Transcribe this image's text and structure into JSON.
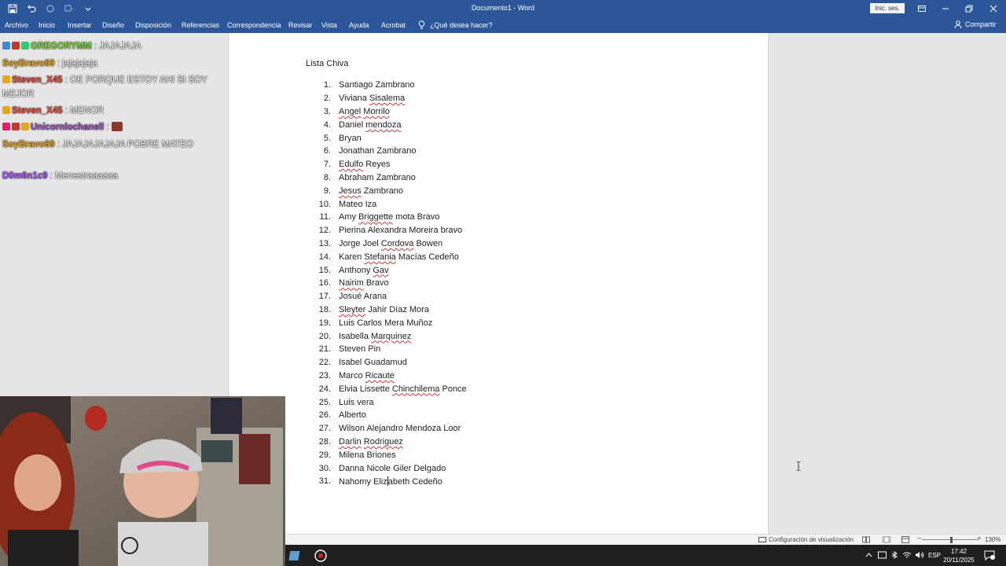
{
  "titlebar": {
    "title": "Documento1  -  Word",
    "signin": "Inic. ses."
  },
  "ribbon": {
    "tabs": [
      "Archivo",
      "Inicio",
      "Insertar",
      "Diseño",
      "Disposición",
      "Referencias",
      "Correspondencia",
      "Revisar",
      "Vista",
      "Ayuda",
      "Acrobat"
    ],
    "tell_me": "¿Qué desea hacer?",
    "share": "Compartir"
  },
  "document": {
    "heading": "Lista Chiva",
    "items": [
      {
        "num": "1.",
        "parts": [
          {
            "t": "Santiago Zambrano",
            "s": false
          }
        ]
      },
      {
        "num": "2.",
        "parts": [
          {
            "t": "Viviana ",
            "s": false
          },
          {
            "t": "Sisalema",
            "s": true
          }
        ]
      },
      {
        "num": "3.",
        "parts": [
          {
            "t": "Angel",
            "s": true
          },
          {
            "t": " ",
            "s": false
          },
          {
            "t": "Morrilo",
            "s": true
          }
        ]
      },
      {
        "num": "4.",
        "parts": [
          {
            "t": "Daniel ",
            "s": false
          },
          {
            "t": "mendoza",
            "s": true
          }
        ]
      },
      {
        "num": "5.",
        "parts": [
          {
            "t": "Bryan",
            "s": false
          }
        ]
      },
      {
        "num": "6.",
        "parts": [
          {
            "t": "Jonathan Zambrano",
            "s": false
          }
        ]
      },
      {
        "num": "7.",
        "parts": [
          {
            "t": "Edulfo",
            "s": true
          },
          {
            "t": " Reyes",
            "s": false
          }
        ]
      },
      {
        "num": "8.",
        "parts": [
          {
            "t": "Abraham Zambrano",
            "s": false
          }
        ]
      },
      {
        "num": "9.",
        "parts": [
          {
            "t": "Jesus",
            "s": true
          },
          {
            "t": " Zambrano",
            "s": false
          }
        ]
      },
      {
        "num": "10.",
        "parts": [
          {
            "t": "Mateo Iza",
            "s": false
          }
        ]
      },
      {
        "num": "11.",
        "parts": [
          {
            "t": "Amy ",
            "s": false
          },
          {
            "t": "Briggette",
            "s": true
          },
          {
            "t": " mota Bravo",
            "s": false
          }
        ]
      },
      {
        "num": "12.",
        "parts": [
          {
            "t": "Pierina Alexandra Moreira bravo",
            "s": false
          }
        ]
      },
      {
        "num": "13.",
        "parts": [
          {
            "t": "Jorge Joel ",
            "s": false
          },
          {
            "t": "Cordova",
            "s": true
          },
          {
            "t": " Bowen",
            "s": false
          }
        ]
      },
      {
        "num": "14.",
        "parts": [
          {
            "t": "Karen ",
            "s": false
          },
          {
            "t": "Stefania",
            "s": true
          },
          {
            "t": " Macías Cedeño",
            "s": false
          }
        ]
      },
      {
        "num": "15.",
        "parts": [
          {
            "t": "Anthony ",
            "s": false
          },
          {
            "t": "Gav",
            "s": true
          }
        ]
      },
      {
        "num": "16.",
        "parts": [
          {
            "t": "Nairim",
            "s": true
          },
          {
            "t": " Bravo",
            "s": false
          }
        ]
      },
      {
        "num": "17.",
        "parts": [
          {
            "t": "Josué Arana",
            "s": false
          }
        ]
      },
      {
        "num": "18.",
        "parts": [
          {
            "t": "Sleyter",
            "s": true
          },
          {
            "t": " Jahir Díaz Mora",
            "s": false
          }
        ]
      },
      {
        "num": "19.",
        "parts": [
          {
            "t": "Luis Carlos Mera Muñoz",
            "s": false
          }
        ]
      },
      {
        "num": "20.",
        "parts": [
          {
            "t": "Isabella ",
            "s": false
          },
          {
            "t": "Marquinez",
            "s": true
          }
        ]
      },
      {
        "num": "21.",
        "parts": [
          {
            "t": "Steven Pin",
            "s": false
          }
        ]
      },
      {
        "num": "22.",
        "parts": [
          {
            "t": "Isabel Guadamud",
            "s": false
          }
        ]
      },
      {
        "num": "23.",
        "parts": [
          {
            "t": "Marco ",
            "s": false
          },
          {
            "t": "Ricaute",
            "s": true
          }
        ]
      },
      {
        "num": "24.",
        "parts": [
          {
            "t": "Elvia Lissette ",
            "s": false
          },
          {
            "t": "Chinchilema",
            "s": true
          },
          {
            "t": " Ponce",
            "s": false
          }
        ]
      },
      {
        "num": "25.",
        "parts": [
          {
            "t": "Luis vera",
            "s": false
          }
        ]
      },
      {
        "num": "26.",
        "parts": [
          {
            "t": "Alberto",
            "s": false
          }
        ]
      },
      {
        "num": "27.",
        "parts": [
          {
            "t": "Wilson Alejandro Mendoza Loor",
            "s": false
          }
        ]
      },
      {
        "num": "28.",
        "parts": [
          {
            "t": "Darlin",
            "s": true
          },
          {
            "t": " ",
            "s": false
          },
          {
            "t": "Rodriguez",
            "s": true
          }
        ]
      },
      {
        "num": "29.",
        "parts": [
          {
            "t": "Milena Briones",
            "s": false
          }
        ]
      },
      {
        "num": "30.",
        "parts": [
          {
            "t": "Danna Nicole Giler Delgado",
            "s": false
          }
        ]
      },
      {
        "num": "31.",
        "parts": [
          {
            "t": "Nahomy Eliz",
            "s": false
          },
          {
            "t": "|caret|",
            "s": false
          },
          {
            "t": "abeth Cedeño",
            "s": false
          }
        ]
      }
    ]
  },
  "chat": {
    "messages": [
      {
        "user": "GREGORYMM",
        "color": "#7cdb3b",
        "text": ": JAJAJAJA",
        "badges": [
          "#3b8ad9",
          "#c0392b",
          "#2ecc71"
        ]
      },
      {
        "user": "SoyBravo69",
        "color": "#e6a817",
        "text": ": jajajajaja",
        "badges": []
      },
      {
        "user": "Steven_X45",
        "color": "#e74c3c",
        "text": ": OE PORQUE ESTOY AHI SI SOY MEJOR",
        "badges": [
          "#e6a817"
        ]
      },
      {
        "user": "Steven_X45",
        "color": "#e74c3c",
        "text": ": MENOR",
        "badges": [
          "#e6a817"
        ]
      },
      {
        "user": "Unicornlochanell",
        "color": "#9b59b6",
        "text": ":",
        "badges": [
          "#e91e63",
          "#c0392b",
          "#e6a817"
        ],
        "emote": true
      },
      {
        "user": "SoyBravo69",
        "color": "#e6a817",
        "text": ": JAJAJAJAJAJA POBRE MATEO",
        "badges": []
      },
      {
        "user": "D0m6n1c9",
        "color": "#a855f7",
        "text": ": Menestraaaaaa",
        "badges": []
      }
    ]
  },
  "statusbar": {
    "display_settings": "Configuración de visualización",
    "zoom": "130%"
  },
  "taskbar": {
    "language": "ESP",
    "time": "17:42",
    "date": "20/11/2025"
  }
}
